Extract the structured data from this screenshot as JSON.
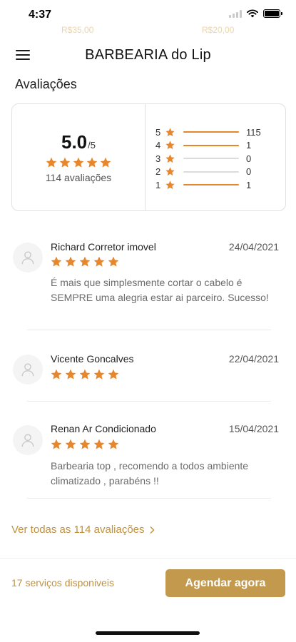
{
  "status_bar": {
    "time": "4:37"
  },
  "ghost_prices": [
    "R$35,00",
    "R$20,00"
  ],
  "header": {
    "title": "BARBEARIA do Lip"
  },
  "reviews_section": {
    "title": "Avaliações",
    "summary": {
      "average": "5.0",
      "max": "/5",
      "stars": 5,
      "count_label": "114 avaliações"
    },
    "distribution": [
      {
        "stars": "5",
        "count": "115",
        "fraction": 1.0
      },
      {
        "stars": "4",
        "count": "1",
        "fraction": 1.0
      },
      {
        "stars": "3",
        "count": "0",
        "fraction": 0
      },
      {
        "stars": "2",
        "count": "0",
        "fraction": 0
      },
      {
        "stars": "1",
        "count": "1",
        "fraction": 1.0
      }
    ],
    "reviews": [
      {
        "name": "Richard Corretor imovel",
        "date": "24/04/2021",
        "stars": 5,
        "text": "É mais que simplesmente cortar o cabelo é SEMPRE uma alegria estar ai parceiro. Sucesso!"
      },
      {
        "name": "Vicente Goncalves",
        "date": "22/04/2021",
        "stars": 5,
        "text": ""
      },
      {
        "name": "Renan Ar Condicionado",
        "date": "15/04/2021",
        "stars": 5,
        "text": "Barbearia top , recomendo a todos ambiente climatizado , parabéns !!"
      }
    ],
    "see_all_label": "Ver todas as 114 avaliações"
  },
  "footer": {
    "services_label": "17 serviços disponiveis",
    "schedule_button": "Agendar agora"
  },
  "colors": {
    "star": "#e8862b",
    "gold_text": "#c1913e",
    "button": "#c39a4d"
  }
}
